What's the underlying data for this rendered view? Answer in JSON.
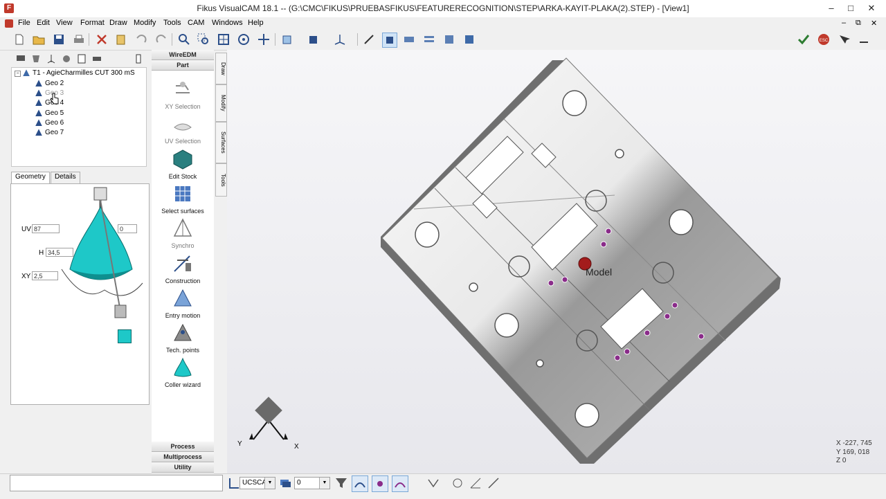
{
  "window": {
    "title": "Fikus VisualCAM 18.1 -- (G:\\CMC\\FIKUS\\PRUEBASFIKUS\\FEATURERECOGNITION\\STEP\\ARKA-KAYIT-PLAKA(2).STEP) - [View1]",
    "app_icon": "F",
    "minimize": "–",
    "maximize": "□",
    "close": "✕"
  },
  "menu": [
    "File",
    "Edit",
    "View",
    "Format",
    "Draw",
    "Modify",
    "Tools",
    "CAM",
    "Windows",
    "Help"
  ],
  "mdi_controls": [
    "–",
    "⧉",
    "✕"
  ],
  "tree": {
    "root": "T1 - AgieCharmilles CUT 300 mS",
    "items": [
      "Geo 2",
      "Geo 3",
      "Geo 4",
      "Geo 5",
      "Geo 6",
      "Geo 7"
    ]
  },
  "tabs": [
    "Geometry",
    "Details"
  ],
  "geometry": {
    "uv_label": "UV",
    "uv_value": "87",
    "uv2_value": "0",
    "h_label": "H",
    "h_value": "34,5",
    "xy_label": "XY",
    "xy_value": "2,5"
  },
  "mid_panel": {
    "headers": [
      "WireEDM",
      "Part"
    ],
    "items": [
      "XY Selection",
      "UV Selection",
      "Edit Stock",
      "Select surfaces",
      "Synchro",
      "Construction",
      "Entry motion",
      "Tech. points",
      "Coller wizard"
    ],
    "footer": [
      "Process",
      "Multiprocess",
      "Utility"
    ]
  },
  "side_tabs": [
    "Draw",
    "Modify",
    "Surfaces",
    "Tools"
  ],
  "viewport": {
    "model_label": "Model",
    "coords": {
      "x": "X -227, 745",
      "y": "Y 169, 018",
      "z": "Z 0"
    },
    "axis_x": "X",
    "axis_y": "Y"
  },
  "statusbar": {
    "ucs_value": "UCSCAM",
    "layer_value": "0"
  },
  "colors": {
    "accent": "#2c4f8a",
    "tool_cyan": "#1ec8c8",
    "confirm_green": "#2e7d32",
    "esc_red": "#c0392b"
  }
}
